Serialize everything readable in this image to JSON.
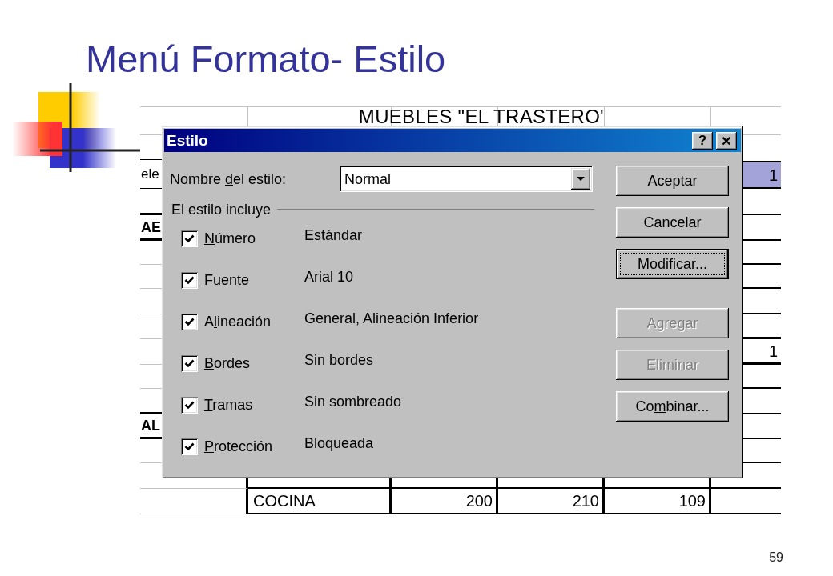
{
  "slide": {
    "title": "Menú Formato- Estilo",
    "page_number": "59"
  },
  "spreadsheet": {
    "title": "MUEBLES \"EL TRASTERO'",
    "rows": [
      {
        "column_1": {
          "text": "ele",
          "selected": false
        },
        "column_6": {
          "text": "1",
          "selected": true
        }
      },
      {
        "column_1": {
          "text": "AE",
          "selected": false
        }
      },
      {
        "column_6": {
          "text": "1",
          "selected": false
        }
      },
      {
        "column_1": {
          "text": "AL",
          "selected": false
        }
      },
      {
        "column_2": {
          "text": "COCINA",
          "selected": false
        },
        "column_3": {
          "text": "200",
          "selected": false
        },
        "column_4": {
          "text": "210",
          "selected": false
        },
        "column_5": {
          "text": "109",
          "selected": false
        }
      }
    ]
  },
  "dialog": {
    "title": "Estilo",
    "title_buttons": [
      {
        "kind": "help",
        "label": "?"
      },
      {
        "kind": "close",
        "label": "×"
      }
    ],
    "style_name": {
      "label": {
        "pre": "Nombre ",
        "key": "d",
        "post": "el estilo:"
      },
      "value": "Normal"
    },
    "style_includes": {
      "title": "El estilo incluye",
      "items": [
        {
          "label": {
            "key": "N",
            "post": "úmero"
          },
          "checked": true,
          "value": "Estándar"
        },
        {
          "label": {
            "key": "F",
            "post": "uente"
          },
          "checked": true,
          "value": "Arial 10"
        },
        {
          "label": {
            "pre": "A",
            "key": "l",
            "post": "ineación"
          },
          "checked": true,
          "value": "General, Alineación Inferior"
        },
        {
          "label": {
            "key": "B",
            "post": "ordes"
          },
          "checked": true,
          "value": "Sin bordes"
        },
        {
          "label": {
            "key": "T",
            "post": "ramas"
          },
          "checked": true,
          "value": "Sin sombreado"
        },
        {
          "label": {
            "key": "P",
            "post": "rotección"
          },
          "checked": true,
          "value": "Bloqueada"
        }
      ]
    },
    "button_groups": [
      {
        "buttons": [
          {
            "label": {
              "pre": "Aceptar"
            },
            "focused": false,
            "disabled": false
          },
          {
            "label": {
              "pre": "Cancelar"
            },
            "focused": false,
            "disabled": false
          },
          {
            "label": {
              "key": "M",
              "post": "odificar..."
            },
            "focused": true,
            "disabled": false
          }
        ]
      },
      {
        "buttons": [
          {
            "label": {
              "pre": "Agregar"
            },
            "focused": false,
            "disabled": true
          },
          {
            "label": {
              "pre": "Eliminar"
            },
            "focused": false,
            "disabled": true
          },
          {
            "label": {
              "pre": "Co",
              "key": "m",
              "post": "binar..."
            },
            "focused": false,
            "disabled": false
          }
        ]
      }
    ]
  }
}
